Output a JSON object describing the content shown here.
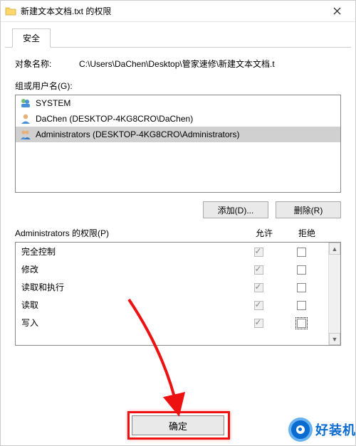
{
  "titlebar": {
    "title": "新建文本文档.txt 的权限"
  },
  "tabs": {
    "security": "安全"
  },
  "object": {
    "label": "对象名称:",
    "value": "C:\\Users\\DaChen\\Desktop\\管家速修\\新建文本文档.t"
  },
  "groups": {
    "label": "组或用户名(G):",
    "items": [
      {
        "name": "SYSTEM",
        "selected": false,
        "iconVariant": "system"
      },
      {
        "name": "DaChen (DESKTOP-4KG8CRO\\DaChen)",
        "selected": false,
        "iconVariant": "user"
      },
      {
        "name": "Administrators (DESKTOP-4KG8CRO\\Administrators)",
        "selected": true,
        "iconVariant": "group"
      }
    ]
  },
  "buttons": {
    "add": "添加(D)...",
    "remove": "删除(R)",
    "ok": "确定"
  },
  "permissions": {
    "header_name": "Administrators 的权限(P)",
    "header_allow": "允许",
    "header_deny": "拒绝",
    "rows": [
      {
        "name": "完全控制",
        "allow": true,
        "allow_disabled": true,
        "deny": false,
        "deny_focus": false
      },
      {
        "name": "修改",
        "allow": true,
        "allow_disabled": true,
        "deny": false,
        "deny_focus": false
      },
      {
        "name": "读取和执行",
        "allow": true,
        "allow_disabled": true,
        "deny": false,
        "deny_focus": false
      },
      {
        "name": "读取",
        "allow": true,
        "allow_disabled": true,
        "deny": false,
        "deny_focus": false
      },
      {
        "name": "写入",
        "allow": true,
        "allow_disabled": true,
        "deny": false,
        "deny_focus": true
      }
    ]
  },
  "watermark": {
    "text": "好装机"
  }
}
